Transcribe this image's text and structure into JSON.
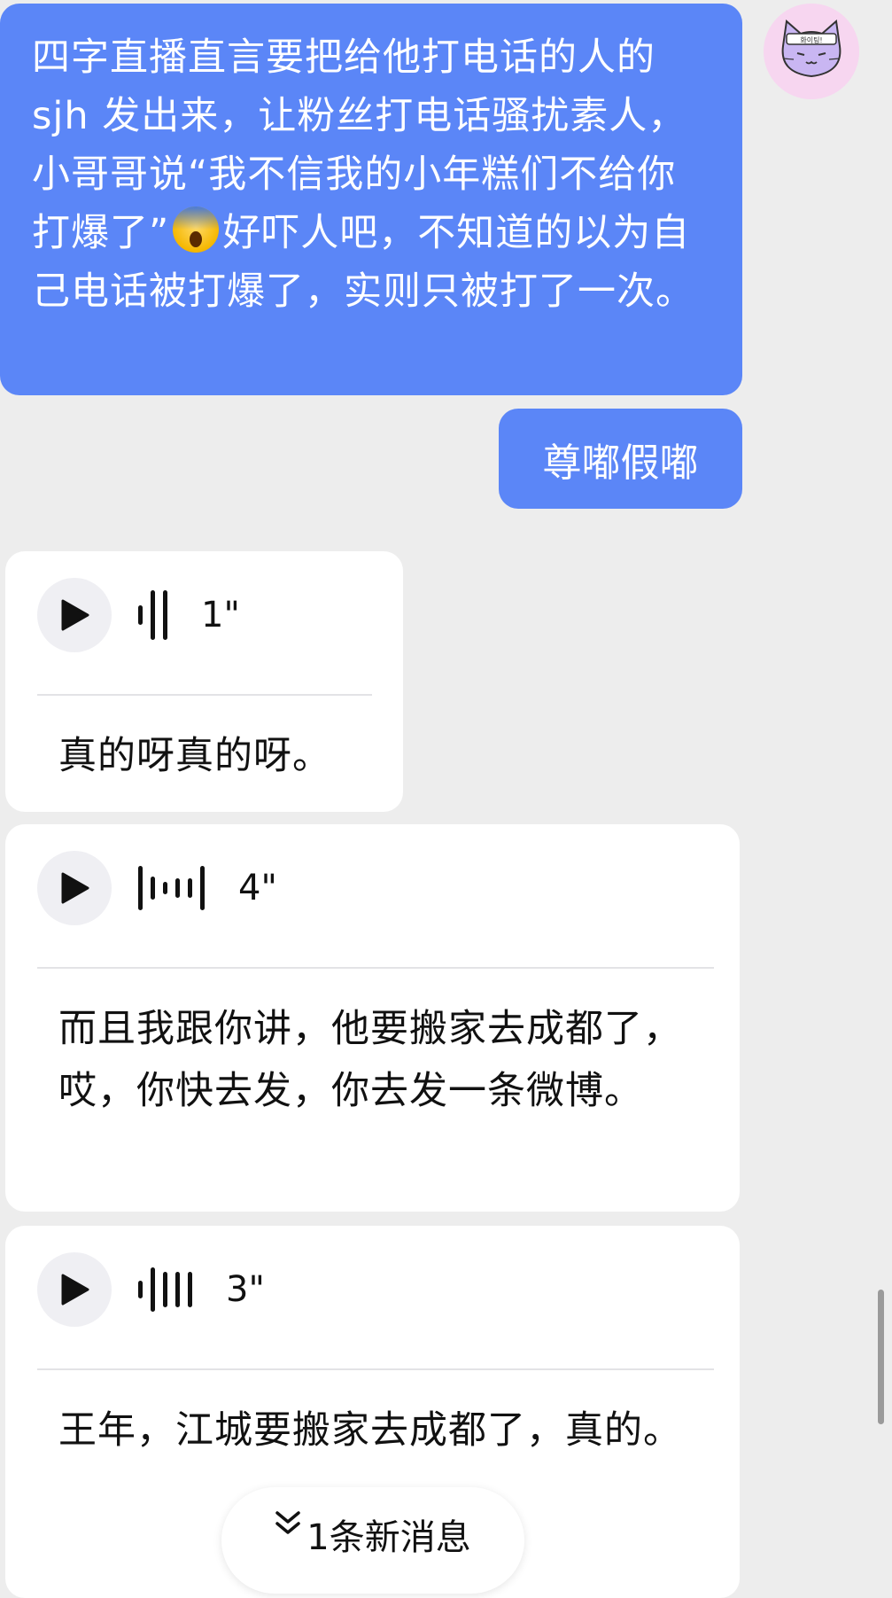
{
  "messages": [
    {
      "side": "out",
      "text_before": "四字直播直言要把给他打电话的人的 sjh 发出来，让粉丝打电话骚扰素人，小哥哥说“我不信我的小年糕们不给你打爆了”",
      "emoji": "😱",
      "text_after": "好吓人吧，不知道的以为自己电话被打爆了，实则只被打了一次。"
    },
    {
      "side": "out",
      "text": "尊嘟假嘟"
    },
    {
      "side": "in",
      "type": "voice",
      "duration": "1\"",
      "transcript": "真的呀真的呀。"
    },
    {
      "side": "in",
      "type": "voice",
      "duration": "4\"",
      "transcript": "而且我跟你讲，他要搬家去成都了，哎，你快去发，你去发一条微博。"
    },
    {
      "side": "in",
      "type": "voice",
      "duration": "3\"",
      "transcript": "王年，江城要搬家去成都了，真的。"
    }
  ],
  "avatar": {
    "icon": "cat-avatar-icon",
    "headband_text": "화이팅!",
    "background": "#f7d6f0"
  },
  "new_message_pill": {
    "icon": "double-chevron-down-icon",
    "label": "1条新消息"
  },
  "colors": {
    "background": "#ededed",
    "outgoing_bubble": "#5b86f7",
    "incoming_bubble": "#ffffff"
  }
}
